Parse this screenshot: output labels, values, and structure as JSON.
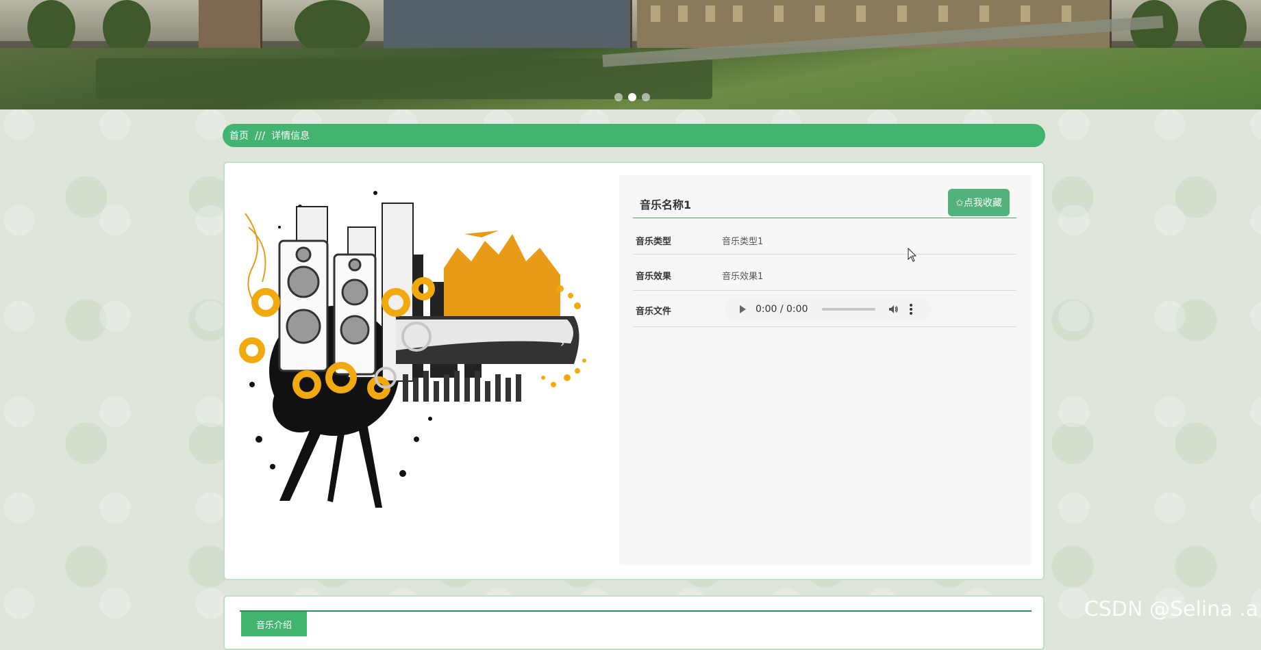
{
  "banner": {
    "slides": 3,
    "active_slide": 1
  },
  "breadcrumb": {
    "home": "首页",
    "separator": "///",
    "current": "详情信息"
  },
  "detail": {
    "title": "音乐名称1",
    "favorite_button": "✩点我收藏",
    "rows": [
      {
        "label": "音乐类型",
        "value": "音乐类型1"
      },
      {
        "label": "音乐效果",
        "value": "音乐效果1"
      },
      {
        "label": "音乐文件",
        "value": ""
      }
    ],
    "audio": {
      "time": "0:00 / 0:00",
      "progress": 0
    }
  },
  "intro": {
    "tab_label": "音乐介绍"
  },
  "watermark": "CSDN @Selina .a",
  "colors": {
    "accent": "#43b470",
    "button": "#53b27a",
    "divider": "#2e8c56"
  }
}
